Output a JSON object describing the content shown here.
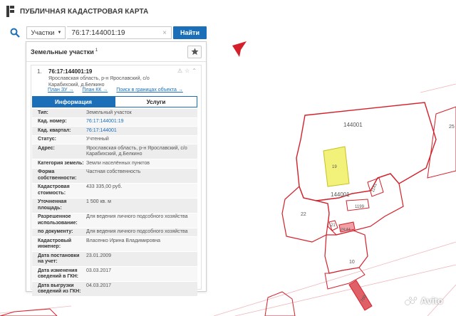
{
  "header": {
    "title": "ПУБЛИЧНАЯ КАДАСТРОВАЯ КАРТА"
  },
  "search": {
    "type_label": "Участки",
    "query": "76:17:144001:19",
    "button": "Найти"
  },
  "panel": {
    "title": "Земельные участки",
    "count": "1",
    "item": {
      "index": "1.",
      "cad_number": "76:17:144001:19",
      "address": "Ярославская область, р-н Ярославский, с/о Карабихский, д.Белкино",
      "links": [
        "План ЗУ →",
        "План КК →",
        "Поиск в границах объекта →"
      ]
    },
    "tabs": [
      "Информация",
      "Услуги"
    ],
    "rows": [
      {
        "k": "Тип:",
        "v": "Земельный участок",
        "link": false
      },
      {
        "k": "Кад. номер:",
        "v": "76:17:144001:19",
        "link": true
      },
      {
        "k": "Кад. квартал:",
        "v": "76:17:144001",
        "link": true
      },
      {
        "k": "Статус:",
        "v": "Учтенный",
        "link": false
      },
      {
        "k": "Адрес:",
        "v": "Ярославская область, р-н Ярославский, с/о Карабихский, д.Белкино",
        "link": false
      },
      {
        "k": "Категория земель:",
        "v": "Земли населённых пунктов",
        "link": false
      },
      {
        "k": "Форма собственности:",
        "v": "Частная собственность",
        "link": false
      },
      {
        "k": "Кадастровая стоимость:",
        "v": "433 335,00 руб.",
        "link": false
      },
      {
        "k": "Уточненная площадь:",
        "v": "1 500 кв. м",
        "link": false
      },
      {
        "k": "Разрешенное использование:",
        "v": "Для ведения личного подсобного хозяйства",
        "link": false
      },
      {
        "k": "по документу:",
        "v": "Для ведения личного подсобного хозяйства",
        "link": false
      },
      {
        "k": "Кадастровый инженер:",
        "v": "Власенко Ирина Владимировна",
        "link": false
      },
      {
        "k": "Дата постановки на учет:",
        "v": "23.01.2009",
        "link": false
      },
      {
        "k": "Дата изменения сведений в ГКН:",
        "v": "03.03.2017",
        "link": false
      },
      {
        "k": "Дата выгрузки сведений из ГКН:",
        "v": "04.03.2017",
        "link": false
      }
    ]
  },
  "map": {
    "labels": [
      "144001",
      "144001",
      "19",
      "22",
      "21",
      "24:44",
      "10",
      "1199",
      "1141",
      "760",
      "25"
    ],
    "colors": {
      "boundary": "#d4202a",
      "selected_fill": "#f2f27a",
      "accent": "#1a6fb8"
    }
  },
  "watermark": {
    "text": "Avito"
  }
}
